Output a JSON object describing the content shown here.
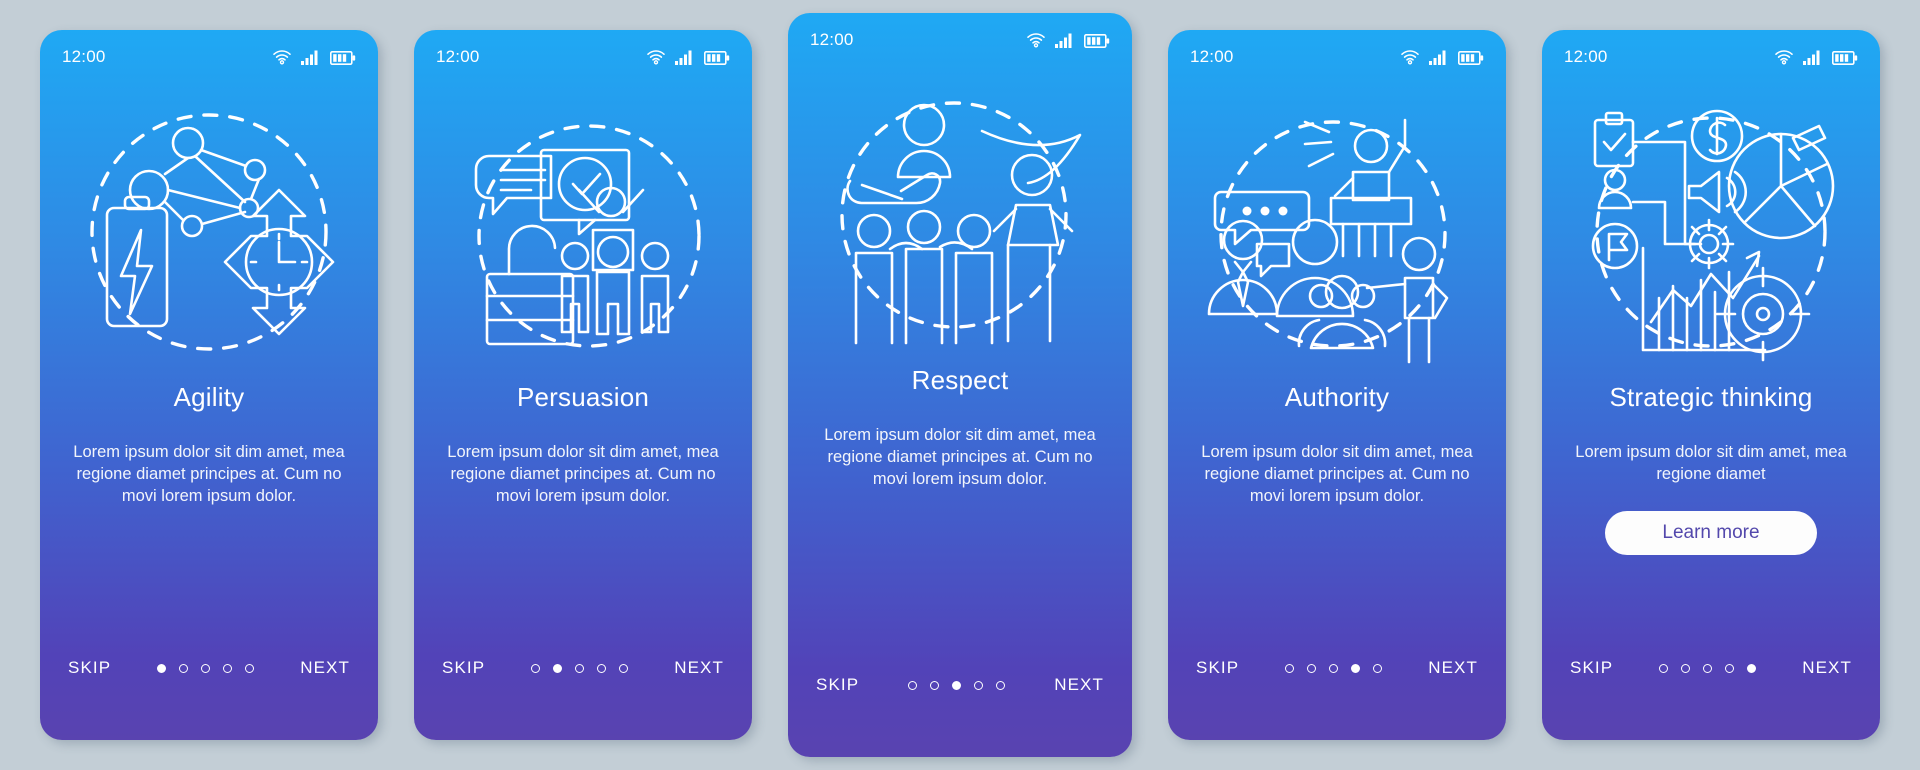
{
  "canvas": {
    "background": "#c3ced6"
  },
  "theme": {
    "gradient_top": "#1fa9f4",
    "gradient_bottom": "#5943b0",
    "text_color": "#ffffff",
    "cta_bg": "#fdfdfd",
    "cta_text": "#5348ac"
  },
  "status": {
    "time": "12:00",
    "wifi_icon": "wifi-icon",
    "signal_icon": "cellular-signal-icon",
    "battery_icon": "battery-icon"
  },
  "nav": {
    "skip_label": "SKIP",
    "next_label": "NEXT",
    "total_dots": 5
  },
  "screens": [
    {
      "id": "agility",
      "title": "Agility",
      "body": "Lorem ipsum dolor sit dim amet, mea regione diamet principes at. Cum no movi lorem ipsum dolor.",
      "active_dot": 1,
      "illustration": "agility-illustration",
      "icons": [
        "network-nodes-icon",
        "battery-lightning-icon",
        "clock-four-arrows-icon",
        "dashed-circle"
      ],
      "cta": null
    },
    {
      "id": "persuasion",
      "title": "Persuasion",
      "body": "Lorem ipsum dolor sit dim amet, mea regione diamet principes at. Cum no movi lorem ipsum dolor.",
      "active_dot": 2,
      "illustration": "persuasion-illustration",
      "icons": [
        "speech-bubble-check-icon",
        "open-padlock-icon",
        "person-on-podium-icon",
        "crowd-icon",
        "dashed-circle"
      ],
      "cta": null
    },
    {
      "id": "respect",
      "title": "Respect",
      "body": "Lorem ipsum dolor sit dim amet, mea regione diamet principes at. Cum no movi lorem ipsum dolor.",
      "active_dot": 3,
      "illustration": "respect-illustration",
      "icons": [
        "hand-holding-person-icon",
        "three-people-together-icon",
        "hero-cape-figure-icon",
        "dashed-circle"
      ],
      "cta": null
    },
    {
      "id": "authority",
      "title": "Authority",
      "body": "Lorem ipsum dolor sit dim amet, mea regione diamet principes at. Cum no movi lorem ipsum dolor.",
      "active_dot": 4,
      "illustration": "authority-illustration",
      "icons": [
        "speaker-at-podium-icon",
        "chat-bubble-dots-icon",
        "business-people-icon",
        "group-people-icon",
        "pointing-figure-icon",
        "dashed-circle"
      ],
      "cta": null
    },
    {
      "id": "strategic-thinking",
      "title": "Strategic thinking",
      "body": "Lorem ipsum dolor sit dim amet, mea regione diamet",
      "active_dot": 5,
      "illustration": "strategic-thinking-illustration",
      "icons": [
        "clipboard-check-icon",
        "dollar-coin-icon",
        "megaphone-icon",
        "gear-icon",
        "flag-pin-icon",
        "user-icon",
        "pie-chart-icon",
        "bar-chart-arrow-icon",
        "target-icon",
        "dashed-circle"
      ],
      "cta": "Learn more"
    }
  ]
}
